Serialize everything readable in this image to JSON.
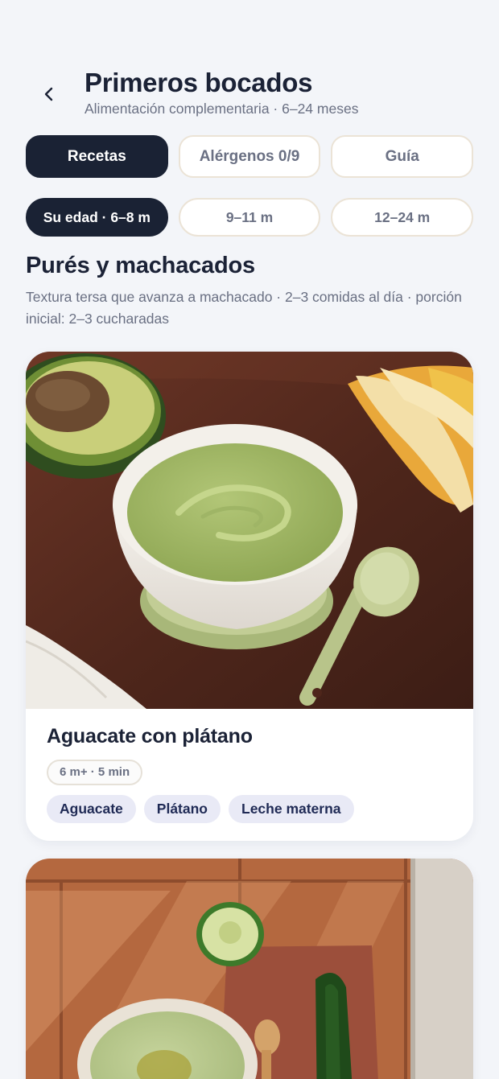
{
  "header": {
    "back_icon": "chevron-left-icon",
    "title": "Primeros bocados",
    "subtitle": "Alimentación complementaria · 6–24 meses"
  },
  "tabs": [
    {
      "label": "Recetas",
      "active": true
    },
    {
      "label": "Alérgenos 0/9",
      "active": false
    },
    {
      "label": "Guía",
      "active": false
    }
  ],
  "age_filters": [
    {
      "label": "Su edad · 6–8 m",
      "active": true
    },
    {
      "label": "9–11 m",
      "active": false
    },
    {
      "label": "12–24 m",
      "active": false
    }
  ],
  "section": {
    "title": "Purés y machacados",
    "description": "Textura tersa que avanza a machacado · 2–3 comidas al día · porción inicial: 2–3 cucharadas"
  },
  "recipes": [
    {
      "title": "Aguacate con plátano",
      "meta": "6 m+ · 5 min",
      "ingredients": [
        "Aguacate",
        "Plátano",
        "Leche materna"
      ]
    }
  ],
  "colors": {
    "background": "#f3f5f9",
    "primary_dark": "#1a2234",
    "muted_text": "#6a7083",
    "chip_border": "#ebe3d6",
    "ingredient_bg": "#e9eaf6",
    "ingredient_text": "#1f2a55"
  }
}
